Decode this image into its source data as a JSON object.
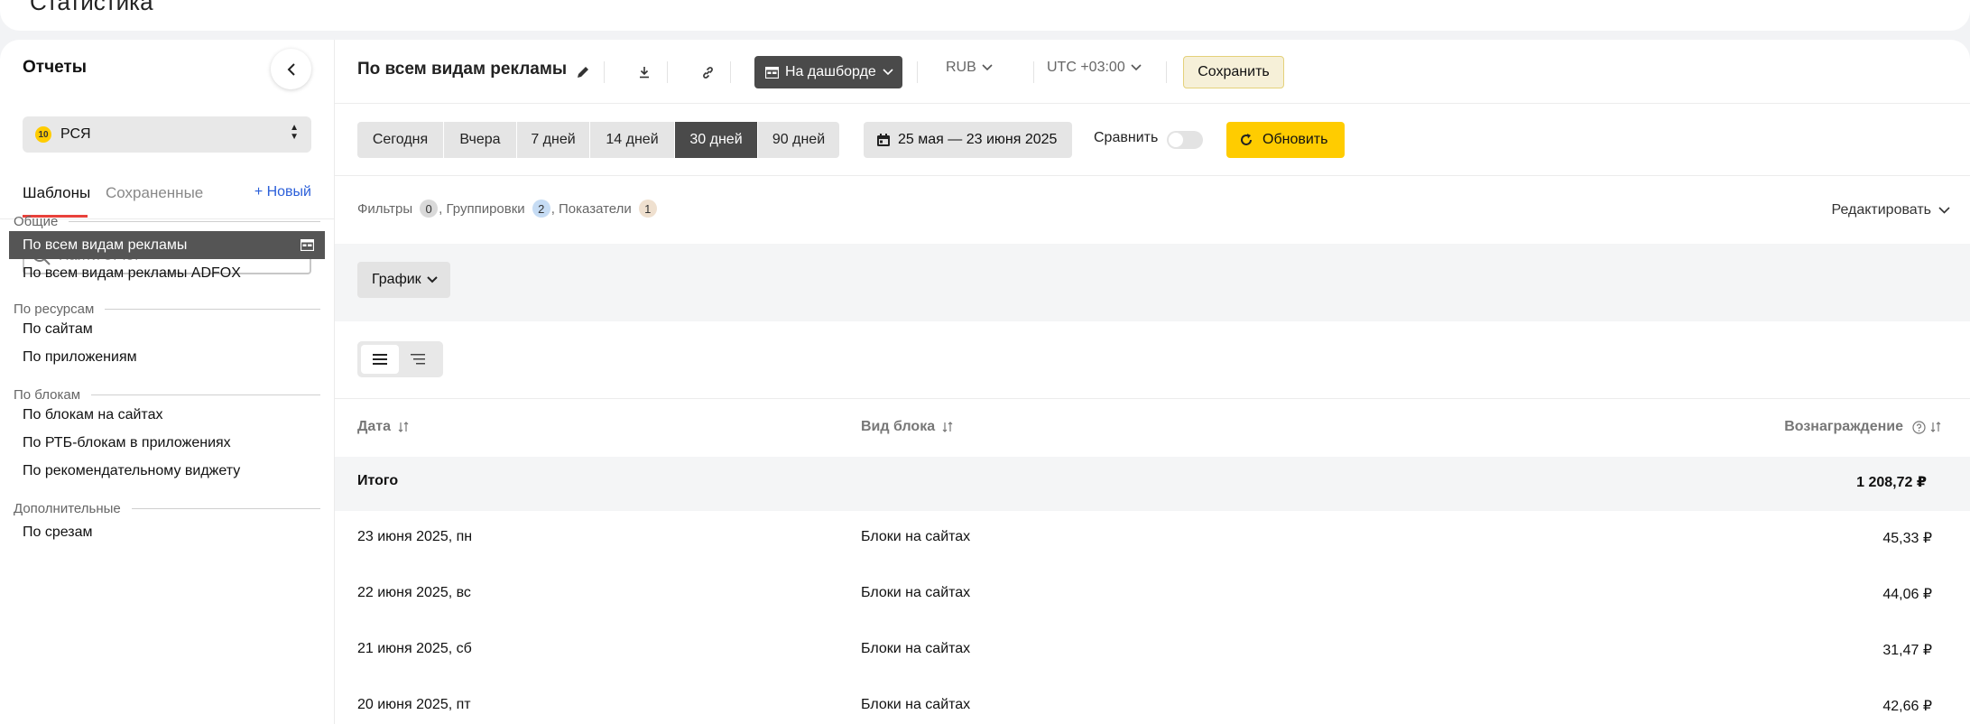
{
  "page": {
    "title": "Статистика"
  },
  "sidebar": {
    "title": "Отчеты",
    "account": {
      "badge": "10",
      "label": "РСЯ"
    },
    "tabs": {
      "templates": "Шаблоны",
      "saved": "Сохраненные",
      "new": "+ Новый"
    },
    "search_placeholder": "Найти отчет",
    "groups": [
      {
        "label": "Общие",
        "items": [
          "По всем видам рекламы",
          "По всем видам рекламы ADFOX"
        ]
      },
      {
        "label": "По ресурсам",
        "items": [
          "По сайтам",
          "По приложениям"
        ]
      },
      {
        "label": "По блокам",
        "items": [
          "По блокам на сайтах",
          "По РТБ-блокам в приложениях",
          "По рекомендательному виджету"
        ]
      },
      {
        "label": "Дополнительные",
        "items": [
          "По срезам"
        ]
      }
    ]
  },
  "header": {
    "report_title": "По всем видам рекламы",
    "dashboard_label": "На дашборде",
    "currency": "RUB",
    "timezone": "UTC +03:00",
    "save_label": "Сохранить"
  },
  "periods": [
    "Сегодня",
    "Вчера",
    "7 дней",
    "14 дней",
    "30 дней",
    "90 дней"
  ],
  "active_period": "30 дней",
  "date_range": "25 мая — 23 июня 2025",
  "compare_label": "Сравнить",
  "refresh_label": "Обновить",
  "filters": {
    "filters_label": "Фильтры",
    "filters_count": "0",
    "groupings_label": ", Группировки",
    "groupings_count": "2",
    "metrics_label": ", Показатели",
    "metrics_count": "1",
    "edit_label": "Редактировать"
  },
  "chart_button": "График",
  "table": {
    "columns": {
      "date": "Дата",
      "block_type": "Вид блока",
      "reward": "Вознаграждение"
    },
    "total": {
      "label": "Итого",
      "value": "1 208,72 ₽"
    },
    "rows": [
      {
        "date": "23 июня 2025, пн",
        "type": "Блоки на сайтах",
        "value": "45,33 ₽"
      },
      {
        "date": "22 июня 2025, вс",
        "type": "Блоки на сайтах",
        "value": "44,06 ₽"
      },
      {
        "date": "21 июня 2025, сб",
        "type": "Блоки на сайтах",
        "value": "31,47 ₽"
      },
      {
        "date": "20 июня 2025, пт",
        "type": "Блоки на сайтах",
        "value": "42,66 ₽"
      }
    ]
  }
}
